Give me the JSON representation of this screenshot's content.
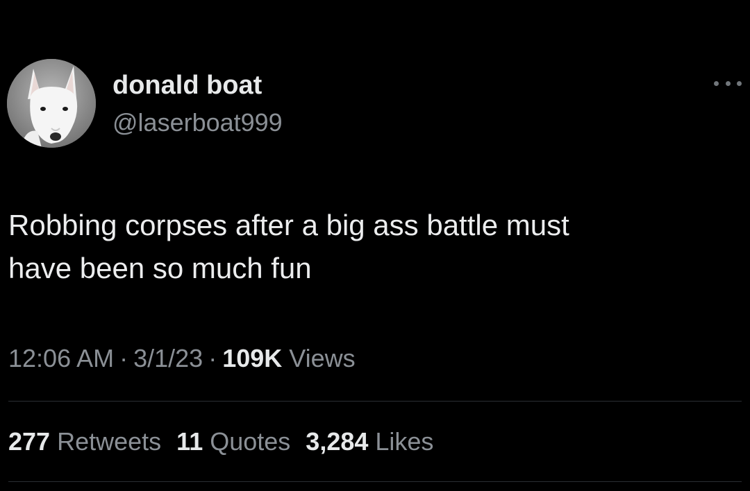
{
  "author": {
    "display_name": "donald boat",
    "handle": "@laserboat999",
    "avatar_icon": "dog-avatar"
  },
  "tweet": {
    "text": "Robbing corpses after a big ass battle must\nhave been so much fun"
  },
  "meta": {
    "time": "12:06 AM",
    "date": "3/1/23",
    "views_count": "109K",
    "views_label": "Views"
  },
  "stats": {
    "retweets_count": "277",
    "retweets_label": "Retweets",
    "quotes_count": "11",
    "quotes_label": "Quotes",
    "likes_count": "3,284",
    "likes_label": "Likes"
  },
  "colors": {
    "background": "#000000",
    "primary_text": "#e7e9ea",
    "secondary_text": "#8b9096",
    "divider": "#2b2f33"
  }
}
